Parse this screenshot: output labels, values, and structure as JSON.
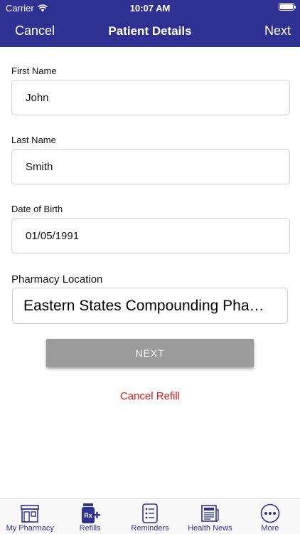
{
  "status": {
    "carrier": "Carrier",
    "time": "10:07 AM"
  },
  "nav": {
    "cancel": "Cancel",
    "title": "Patient Details",
    "next": "Next"
  },
  "form": {
    "first_name_label": "First Name",
    "first_name_value": "John",
    "last_name_label": "Last Name",
    "last_name_value": "Smith",
    "dob_label": "Date of Birth",
    "dob_value": "01/05/1991",
    "pharmacy_label": "Pharmacy Location",
    "pharmacy_value": "Eastern States Compounding Pha…"
  },
  "actions": {
    "next_button": "NEXT",
    "cancel_refill": "Cancel Refill"
  },
  "tabs": [
    {
      "label": "My Pharmacy",
      "icon": "pharmacy-store-icon"
    },
    {
      "label": "Refills",
      "icon": "rx-refill-icon"
    },
    {
      "label": "Reminders",
      "icon": "reminders-list-icon"
    },
    {
      "label": "Health News",
      "icon": "newspaper-icon"
    },
    {
      "label": "More",
      "icon": "more-dots-icon"
    }
  ],
  "colors": {
    "brand": "#2e3192",
    "danger": "#e01414",
    "button_disabled": "#9b9b9b"
  }
}
